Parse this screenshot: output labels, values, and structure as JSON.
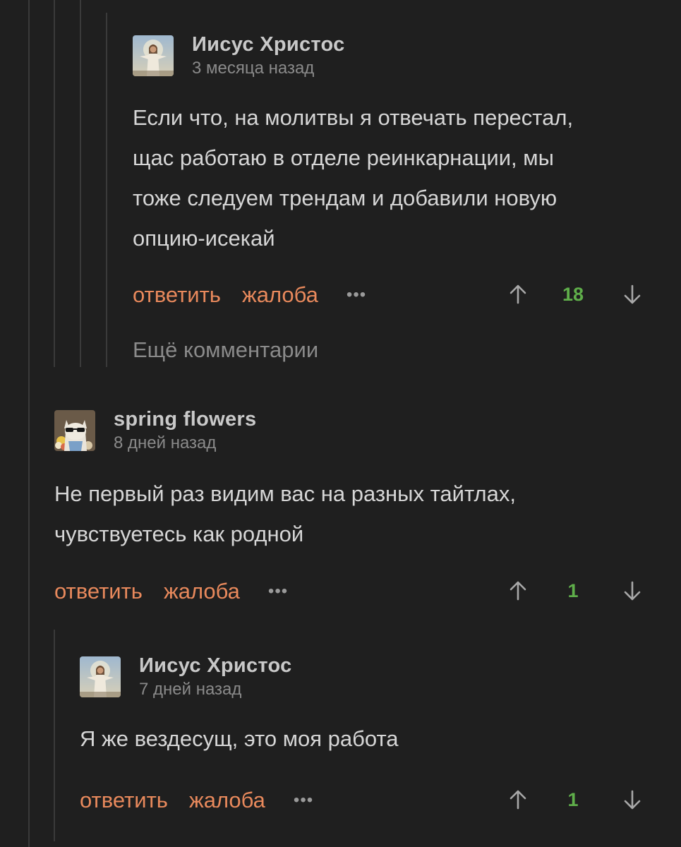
{
  "comments": [
    {
      "author": "Иисус Христос",
      "time": "3 месяца назад",
      "lines": [
        "Если что, на молитвы я отвечать перестал,",
        "щас работаю в отделе реинкарнации, мы",
        "тоже следуем трендам и добавили новую",
        "опцию-исекай"
      ],
      "reply_label": "ответить",
      "report_label": "жалоба",
      "more_label": "•••",
      "votes": "18"
    },
    {
      "author": "spring flowers",
      "time": "8 дней назад",
      "lines": [
        "Не первый раз видим вас на разных тайтлах,",
        "чувствуетесь как родной"
      ],
      "reply_label": "ответить",
      "report_label": "жалоба",
      "more_label": "•••",
      "votes": "1"
    },
    {
      "author": "Иисус Христос",
      "time": "7 дней назад",
      "lines": [
        "Я же вездесущ, это моя работа"
      ],
      "reply_label": "ответить",
      "report_label": "жалоба",
      "more_label": "•••",
      "votes": "1"
    }
  ],
  "more_comments_label": "Ещё комментарии",
  "colors": {
    "background": "#1f1f1f",
    "action": "#e8895c",
    "vote_count": "#5fae4a",
    "thread_line": "#3a3a3a"
  }
}
